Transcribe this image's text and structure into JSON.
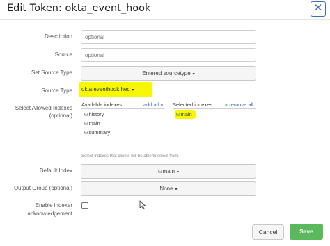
{
  "dialog": {
    "title": "Edit Token: okta_event_hook",
    "close_icon": "close-icon",
    "accent": "#3b6fb6"
  },
  "form": {
    "description": {
      "label": "Description",
      "placeholder": "optional"
    },
    "source": {
      "label": "Source",
      "placeholder": "optional"
    },
    "set_source_type": {
      "label": "Set Source Type",
      "value": "Entered sourcetype"
    },
    "source_type": {
      "label": "Source Type",
      "value": "okta:eventhook:hec",
      "highlight": "#f7f700"
    },
    "indexes": {
      "label_line1": "Select Allowed Indexes",
      "label_line2": "(optional)",
      "available_title": "Available indexes",
      "add_all": "add all »",
      "available": [
        "history",
        "main",
        "summary"
      ],
      "selected_title": "Selected indexes",
      "remove_all": "« remove all",
      "selected": [
        "main"
      ],
      "help": "Select indexes that clients will be able to select from."
    },
    "default_index": {
      "label": "Default Index",
      "value": "main"
    },
    "output_group": {
      "label": "Output Group (optional)",
      "value": "None"
    },
    "indexer_ack": {
      "label_line1": "Enable indexer",
      "label_line2": "acknowledgement",
      "checked": false
    }
  },
  "footer": {
    "cancel_label": "Cancel",
    "save_label": "Save",
    "save_color": "#5cb85c"
  },
  "icons": {
    "index_icon": "⛁",
    "caret": "▾",
    "close": "✕"
  }
}
